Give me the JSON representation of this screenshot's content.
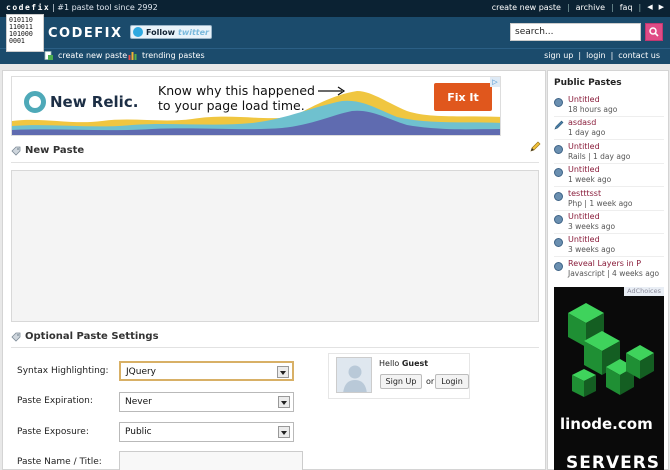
{
  "topbar": {
    "brand": "codefix",
    "tagline": "| #1 paste tool since 2992",
    "links": [
      "create new paste",
      "archive",
      "faq"
    ]
  },
  "header": {
    "logo_bits": [
      "010110",
      "110011",
      "101000",
      "0001"
    ],
    "logo_text": "CODEFIX",
    "twitter_follow": "Follow",
    "twitter_brand": "twitter"
  },
  "search": {
    "value": "search..."
  },
  "subnav": {
    "create": "create new paste",
    "trending": "trending pastes",
    "signup": "sign up",
    "login": "login",
    "contact": "contact us",
    "sep": "|"
  },
  "ad_top": {
    "brand": "New Relic.",
    "headline_1": "Know why this happened",
    "headline_2": "to your page load time.",
    "cta": "Fix It"
  },
  "new_paste": {
    "title": "New Paste"
  },
  "settings": {
    "title": "Optional Paste Settings",
    "syntax_label": "Syntax Highlighting:",
    "syntax_value": "JQuery",
    "expiration_label": "Paste Expiration:",
    "expiration_value": "Never",
    "exposure_label": "Paste Exposure:",
    "exposure_value": "Public",
    "name_label": "Paste Name / Title:"
  },
  "guest": {
    "hello": "Hello",
    "name": "Guest",
    "signup": "Sign Up",
    "or": "or",
    "login": "Login"
  },
  "sidebar": {
    "title": "Public Pastes",
    "items": [
      {
        "title": "Untitled",
        "meta": "18 hours ago",
        "icon": "globe-icon"
      },
      {
        "title": "asdasd",
        "meta": "1 day ago",
        "icon": "pencil-icon"
      },
      {
        "title": "Untitled",
        "meta": "Rails | 1 day ago",
        "icon": "globe-icon"
      },
      {
        "title": "Untitled",
        "meta": "1 week ago",
        "icon": "globe-icon"
      },
      {
        "title": "testttsst",
        "meta": "Php | 1 week ago",
        "icon": "globe-icon"
      },
      {
        "title": "Untitled",
        "meta": "3 weeks ago",
        "icon": "globe-icon"
      },
      {
        "title": "Untitled",
        "meta": "3 weeks ago",
        "icon": "globe-icon"
      },
      {
        "title": "Reveal Layers in P",
        "meta": "Javascript | 4 weeks ago",
        "icon": "globe-icon"
      }
    ]
  },
  "side_ad": {
    "adchoices": "AdChoices",
    "brand": "linode.com",
    "tagline": "SERVERS"
  },
  "colors": {
    "header": "#1b4b6c",
    "topbar": "#0b2233",
    "paste_link": "#8a1d3b",
    "search_button": "#e04b86"
  }
}
